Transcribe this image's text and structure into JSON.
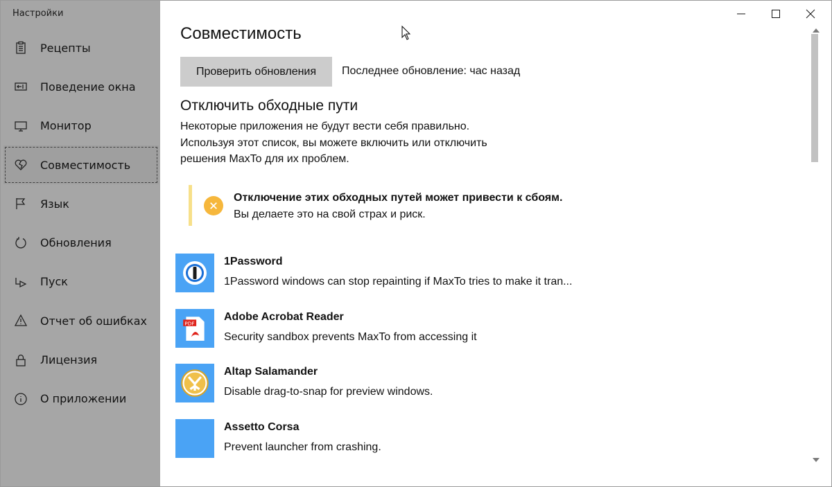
{
  "window": {
    "title": "Настройки",
    "controls": [
      "minimize",
      "maximize",
      "close"
    ]
  },
  "sidebar": {
    "items": [
      {
        "label": "Рецепты",
        "icon": "clipboard-icon"
      },
      {
        "label": "Поведение окна",
        "icon": "window-behavior-icon"
      },
      {
        "label": "Монитор",
        "icon": "monitor-icon"
      },
      {
        "label": "Совместимость",
        "icon": "broken-heart-icon",
        "selected": true
      },
      {
        "label": "Язык",
        "icon": "flag-icon"
      },
      {
        "label": "Обновления",
        "icon": "refresh-icon"
      },
      {
        "label": "Пуск",
        "icon": "startup-icon"
      },
      {
        "label": "Отчет об ошибках",
        "icon": "warning-icon"
      },
      {
        "label": "Лицензия",
        "icon": "lock-icon"
      },
      {
        "label": "О приложении",
        "icon": "info-icon"
      }
    ]
  },
  "main": {
    "title": "Совместимость",
    "check_button": "Проверить обновления",
    "last_update": "Последнее обновление: час назад",
    "section_title": "Отключить обходные пути",
    "description": [
      "Некоторые приложения не будут вести себя правильно.",
      "Используя этот список, вы можете включить или отключить",
      "решения MaxTo для их проблем."
    ],
    "warning": {
      "title": "Отключение этих обходных путей может привести к сбоям.",
      "text": "Вы делаете это на свой страх и риск.",
      "color": "#f6b73c"
    },
    "apps": [
      {
        "name": "1Password",
        "description": "1Password windows can stop repainting if MaxTo tries to make it tran...",
        "icon": "onepassword-icon"
      },
      {
        "name": "Adobe Acrobat Reader",
        "description": "Security sandbox prevents MaxTo from accessing it",
        "icon": "pdf-icon"
      },
      {
        "name": "Altap Salamander",
        "description": "Disable drag-to-snap for preview windows.",
        "icon": "salamander-icon"
      },
      {
        "name": "Assetto Corsa",
        "description": "Prevent launcher from crashing.",
        "icon": "blank-app-icon"
      }
    ]
  },
  "colors": {
    "sidebar_bg": "#a6a6a6",
    "app_tile": "#4aa3f5",
    "warning_bar": "#f7e08a",
    "button_bg": "#cccccc"
  }
}
